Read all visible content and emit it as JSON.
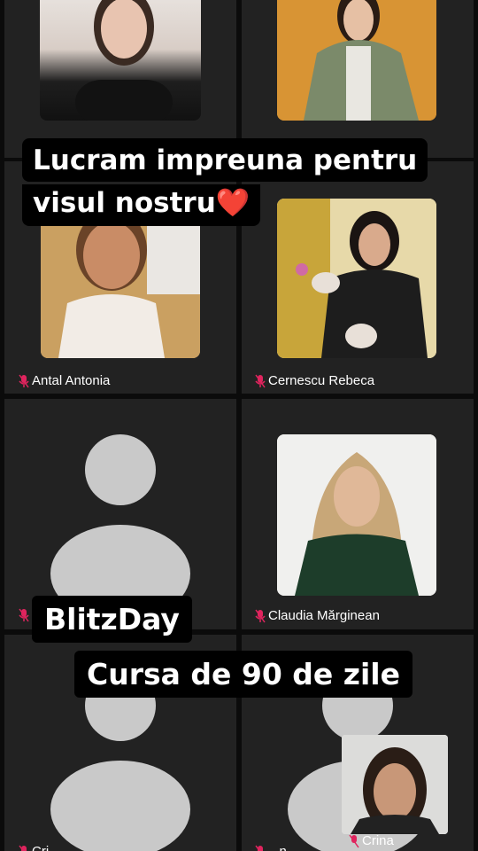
{
  "participants": [
    {
      "name": ""
    },
    {
      "name": ""
    },
    {
      "name": "Antal Antonia"
    },
    {
      "name": "Cernescu Rebeca"
    },
    {
      "name": ""
    },
    {
      "name": "Claudia Mărginean"
    },
    {
      "name": "Cri..."
    },
    {
      "name": "...n"
    }
  ],
  "self_view": {
    "name": "Crina"
  },
  "captions": {
    "top_line1": "Lucram impreuna pentru",
    "top_line2": "visul nostru",
    "top_heart": "❤️",
    "blitz": "BlitzDay",
    "course": "Cursa de 90 de zile"
  },
  "colors": {
    "mic_muted": "#e0245e",
    "tile_bg": "#222222",
    "avatar": "#c9c9c9"
  },
  "icons": {
    "mic": "mic-muted-icon"
  }
}
